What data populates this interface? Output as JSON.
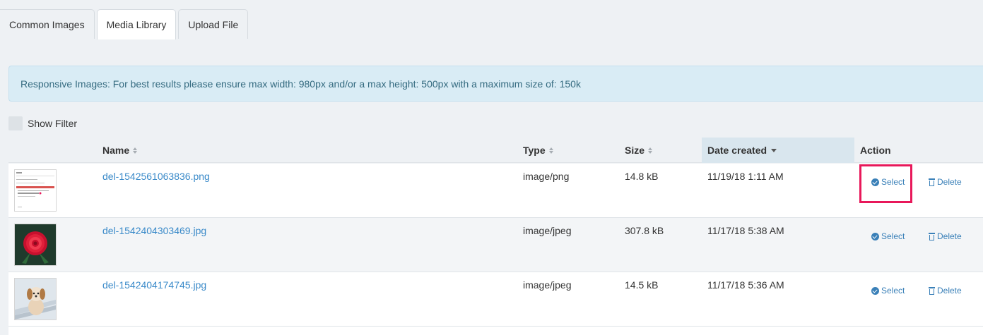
{
  "tabs": [
    {
      "label": "Common Images",
      "active": false
    },
    {
      "label": "Media Library",
      "active": true
    },
    {
      "label": "Upload File",
      "active": false
    }
  ],
  "alert": {
    "text": "Responsive Images: For best results please ensure max width: 980px and/or a max height: 500px with a maximum size of: 150k"
  },
  "filter": {
    "label": "Show Filter",
    "checked": false
  },
  "table": {
    "columns": {
      "name": "Name",
      "type": "Type",
      "size": "Size",
      "date": "Date created",
      "action": "Action"
    },
    "sorted_column": "Date created",
    "sort_direction": "descending",
    "rows": [
      {
        "name": "del-1542561063836.png",
        "type": "image/png",
        "size": "14.8 kB",
        "date": "11/19/18 1:11 AM",
        "select": "Select",
        "delete": "Delete",
        "thumb": "screenshot-thumbnail"
      },
      {
        "name": "del-1542404303469.jpg",
        "type": "image/jpeg",
        "size": "307.8 kB",
        "date": "11/17/18 5:38 AM",
        "select": "Select",
        "delete": "Delete",
        "thumb": "red-flower-thumbnail"
      },
      {
        "name": "del-1542404174745.jpg",
        "type": "image/jpeg",
        "size": "14.5 kB",
        "date": "11/17/18 5:36 AM",
        "select": "Select",
        "delete": "Delete",
        "thumb": "puppy-thumbnail"
      }
    ]
  },
  "colors": {
    "link": "#3a8ac9",
    "highlight": "#e8185a",
    "alert_bg": "#d9ecf5",
    "sorted_header_bg": "#d9e6ee"
  }
}
